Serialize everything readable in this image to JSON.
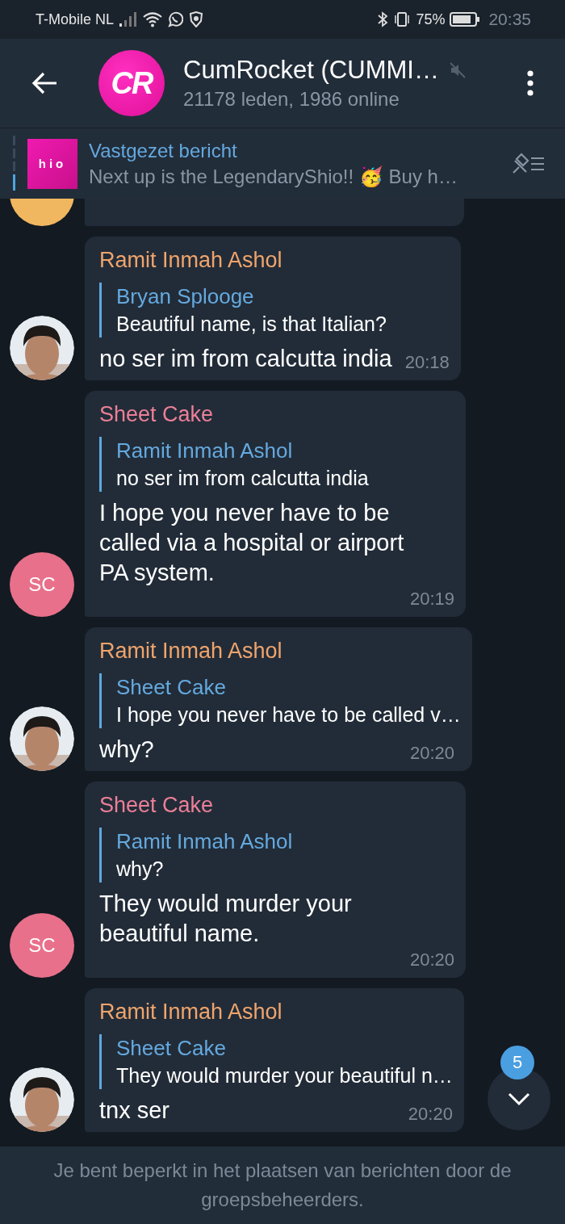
{
  "status_bar": {
    "carrier": "T-Mobile NL",
    "battery": "75%",
    "time": "20:35"
  },
  "header": {
    "avatar_text": "CR",
    "title": "CumRocket (CUMMI…",
    "subtitle": "21178 leden, 1986 online",
    "muted": true
  },
  "pinned": {
    "thumbnail_text": "hio",
    "title": "Vastgezet bericht",
    "text": "Next up is the LegendaryShio!! 🥳  Buy h…"
  },
  "messages": [
    {
      "sender": "Ramit Inmah Ashol",
      "color": "#f0a46c",
      "reply": {
        "author": "Bryan Splooge",
        "text": "Beautiful name, is that Italian?"
      },
      "text": "no ser im from calcutta india",
      "time": "20:18"
    },
    {
      "sender": "Sheet Cake",
      "color": "#ec7f98",
      "avatar": {
        "kind": "initials",
        "text": "SC",
        "color": "#e8708a"
      },
      "reply": {
        "author": "Ramit Inmah Ashol",
        "text": "no ser im from calcutta india"
      },
      "text": "I hope you never have to be called via a hospital or airport PA system.",
      "time": "20:19"
    },
    {
      "sender": "Ramit Inmah Ashol",
      "color": "#f0a46c",
      "reply": {
        "author": "Sheet Cake",
        "text": "I hope you never have to be called v…"
      },
      "text": "why?",
      "time": "20:20"
    },
    {
      "sender": "Sheet Cake",
      "color": "#ec7f98",
      "avatar": {
        "kind": "initials",
        "text": "SC",
        "color": "#e8708a"
      },
      "reply": {
        "author": "Ramit Inmah Ashol",
        "text": "why?"
      },
      "text": "They would murder your beautiful name.",
      "time": "20:20"
    },
    {
      "sender": "Ramit Inmah Ashol",
      "color": "#f0a46c",
      "reply": {
        "author": "Sheet Cake",
        "text": "They would murder your beautiful n…"
      },
      "text": "tnx ser",
      "time": "20:20"
    }
  ],
  "scroll_button": {
    "unread": "5"
  },
  "footer": {
    "notice": "Je bent beperkt in het plaatsen van berichten door de groepsbeheerders."
  }
}
